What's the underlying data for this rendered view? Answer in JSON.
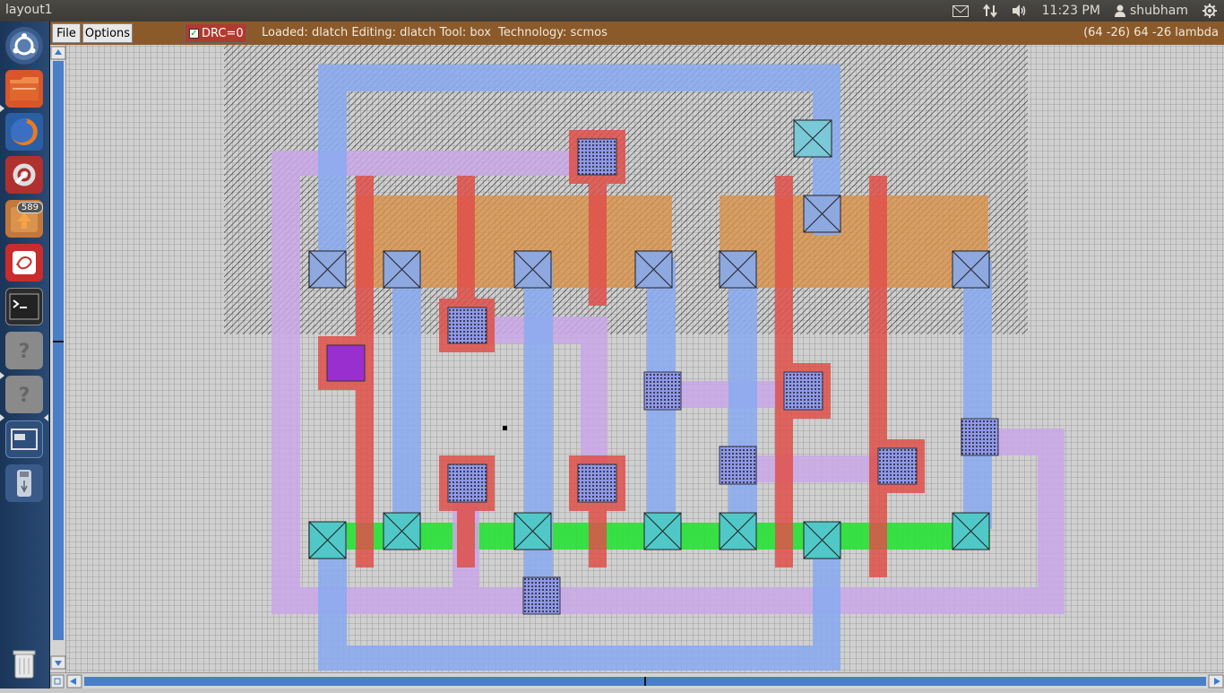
{
  "window": {
    "title": "layout1"
  },
  "panel": {
    "clock": "11:23 PM",
    "user": "shubham"
  },
  "launcher": {
    "items": [
      {
        "name": "dash",
        "icon": "ubuntu-logo-icon"
      },
      {
        "name": "files",
        "icon": "folder-icon"
      },
      {
        "name": "firefox",
        "icon": "firefox-icon"
      },
      {
        "name": "system-settings",
        "icon": "settings-icon"
      },
      {
        "name": "update-manager",
        "icon": "update-icon",
        "badge": "589"
      },
      {
        "name": "text-editor",
        "icon": "editor-icon"
      },
      {
        "name": "terminal",
        "icon": "terminal-icon"
      },
      {
        "name": "unknown-app-1",
        "icon": "question-icon"
      },
      {
        "name": "unknown-app-2",
        "icon": "question-icon"
      },
      {
        "name": "workspace-switcher",
        "icon": "workspace-icon"
      },
      {
        "name": "usb-drive",
        "icon": "usb-icon"
      },
      {
        "name": "trash",
        "icon": "trash-icon"
      }
    ]
  },
  "menubar": {
    "file_label": "File",
    "options_label": "Options",
    "drc_label": "DRC=0",
    "status": "Loaded: dlatch Editing: dlatch Tool: box  Technology: scmos",
    "coords": "(64 -26) 64 -26 lambda"
  },
  "colors": {
    "menubar": "#8b5a2b",
    "metal1": "#8aaaf0",
    "metal2": "#c4a8e4",
    "poly": "#e05a5a",
    "pdiff": "#d99a55",
    "ndiff": "#3cd84a",
    "nwell": "#000000",
    "launcher": "#2a4a74"
  }
}
